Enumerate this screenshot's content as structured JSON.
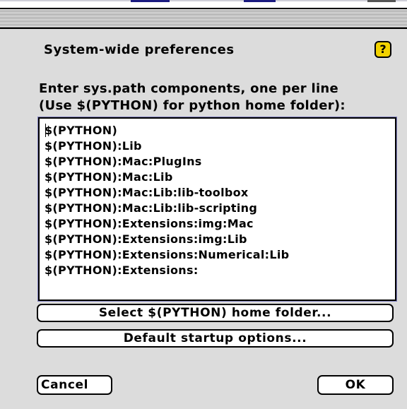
{
  "window": {
    "heading": "System-wide preferences",
    "help_icon_glyph": "?"
  },
  "instructions": {
    "line1": "Enter sys.path components, one per line",
    "line2": "(Use $(PYTHON) for python home folder):"
  },
  "path_list": [
    "$(PYTHON)",
    "$(PYTHON):Lib",
    "$(PYTHON):Mac:PlugIns",
    "$(PYTHON):Mac:Lib",
    "$(PYTHON):Mac:Lib:lib-toolbox",
    "$(PYTHON):Mac:Lib:lib-scripting",
    "$(PYTHON):Extensions:img:Mac",
    "$(PYTHON):Extensions:img:Lib",
    "$(PYTHON):Extensions:Numerical:Lib",
    "$(PYTHON):Extensions:"
  ],
  "buttons": {
    "select_home": "Select $(PYTHON) home folder...",
    "default_startup": "Default startup options...",
    "cancel": "Cancel",
    "ok": "OK"
  },
  "colors": {
    "dialog_bg": "#dcdcdc",
    "help_icon": "#f2d200",
    "list_focus": "#8080c0"
  }
}
